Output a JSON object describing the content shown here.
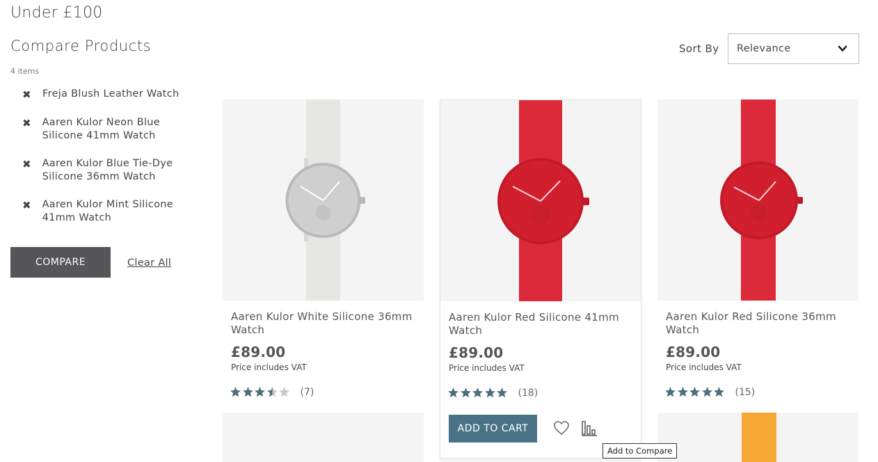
{
  "page": {
    "title": "Under £100"
  },
  "compare": {
    "title": "Compare Products",
    "count": "4 items",
    "items": [
      {
        "label": "Freja Blush Leather Watch"
      },
      {
        "label": "Aaren Kulor Neon Blue Silicone 41mm Watch"
      },
      {
        "label": "Aaren Kulor Blue Tie-Dye Silicone 36mm Watch"
      },
      {
        "label": "Aaren Kulor Mint Silicone 41mm Watch"
      }
    ],
    "remove_icon": "✖",
    "compare_button": "COMPARE",
    "clear_all": "Clear All"
  },
  "sort": {
    "label": "Sort By",
    "value": "Relevance"
  },
  "products": [
    {
      "name": "Aaren Kulor White Silicone 36mm Watch",
      "price": "£89.00",
      "vat": "Price includes VAT",
      "rating": 3.5,
      "reviews": "(7)",
      "strap_color": "#e6e6e4",
      "dial_color": "#cfcfd0",
      "case_color": "#b9babc"
    },
    {
      "name": "Aaren Kulor Red Silicone 41mm Watch",
      "price": "£89.00",
      "vat": "Price includes VAT",
      "rating": 5,
      "reviews": "(18)",
      "strap_color": "#dc2a3a",
      "dial_color": "#d21f2e",
      "case_color": "#c21a2a",
      "add_to_cart": "ADD TO CART"
    },
    {
      "name": "Aaren Kulor Red Silicone 36mm Watch",
      "price": "£89.00",
      "vat": "Price includes VAT",
      "rating": 5,
      "reviews": "(15)",
      "strap_color": "#dc2a3a",
      "dial_color": "#d21f2e",
      "case_color": "#c21a2a"
    }
  ],
  "tooltip": "Add to Compare",
  "colors": {
    "accent": "#4a7388",
    "star_filled": "#4c6e7d",
    "star_empty": "#c8c8c8",
    "compare_button": "#55555a"
  },
  "icons": {
    "heart": "heart-icon",
    "compare": "bar-chart-icon",
    "sort": "chevron-down-icon",
    "remove": "close-icon"
  }
}
